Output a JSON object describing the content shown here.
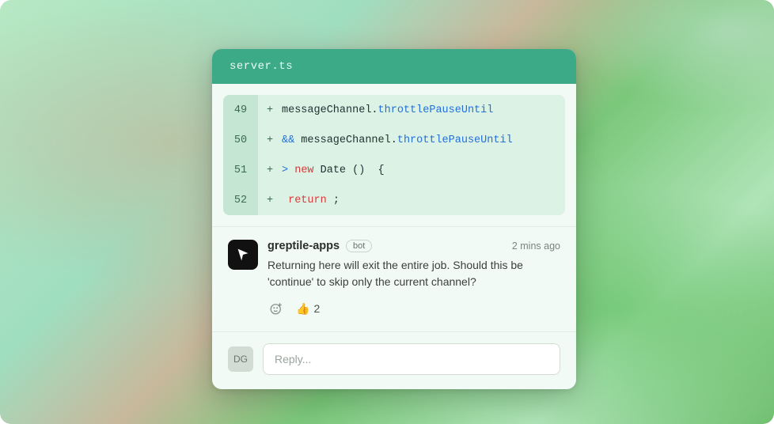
{
  "header": {
    "filename": "server.ts"
  },
  "code": {
    "lines": [
      {
        "no": "49",
        "mark": "+",
        "tokens": [
          {
            "t": "messageChannel",
            "c": "tok-obj"
          },
          {
            "t": ".",
            "c": "tok-dot"
          },
          {
            "t": "throttlePauseUntil",
            "c": "tok-prop"
          }
        ]
      },
      {
        "no": "50",
        "mark": "+",
        "tokens": [
          {
            "t": "&&",
            "c": "tok-op"
          },
          {
            "t": " messageChannel",
            "c": "tok-obj"
          },
          {
            "t": ".",
            "c": "tok-dot"
          },
          {
            "t": "throttlePauseUntil",
            "c": "tok-prop"
          }
        ]
      },
      {
        "no": "51",
        "mark": "+",
        "tokens": [
          {
            "t": ">",
            "c": "tok-gt"
          },
          {
            "t": " ",
            "c": ""
          },
          {
            "t": "new",
            "c": "tok-kw-new"
          },
          {
            "t": " Date ()  {",
            "c": "tok-type"
          }
        ]
      },
      {
        "no": "52",
        "mark": "+",
        "tokens": [
          {
            "t": " return",
            "c": "tok-return"
          },
          {
            "t": " ;",
            "c": "tok-punc"
          }
        ]
      }
    ]
  },
  "comment": {
    "author": "greptile-apps",
    "badge": "bot",
    "timestamp": "2 mins ago",
    "text": "Returning here will exit the entire job. Should this be 'continue' to skip only the current channel?",
    "reaction_emoji": "👍",
    "reaction_count": "2"
  },
  "reply": {
    "avatar_initials": "DG",
    "placeholder": "Reply..."
  }
}
